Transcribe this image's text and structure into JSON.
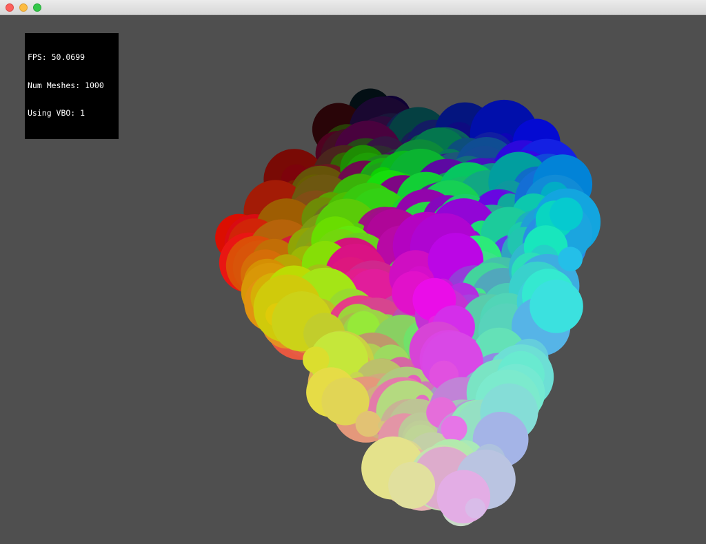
{
  "window": {
    "controls": [
      "close",
      "minimize",
      "zoom"
    ]
  },
  "stats": {
    "fps": "FPS: 50.0699",
    "num_meshes": "Num Meshes: 1000",
    "using_vbo": "Using VBO: 1"
  },
  "scene": {
    "background_color": "#4f4f4f",
    "description_colors": [
      "#000000",
      "#ff0000",
      "#00ff00",
      "#0000ff",
      "#ffffff"
    ]
  }
}
